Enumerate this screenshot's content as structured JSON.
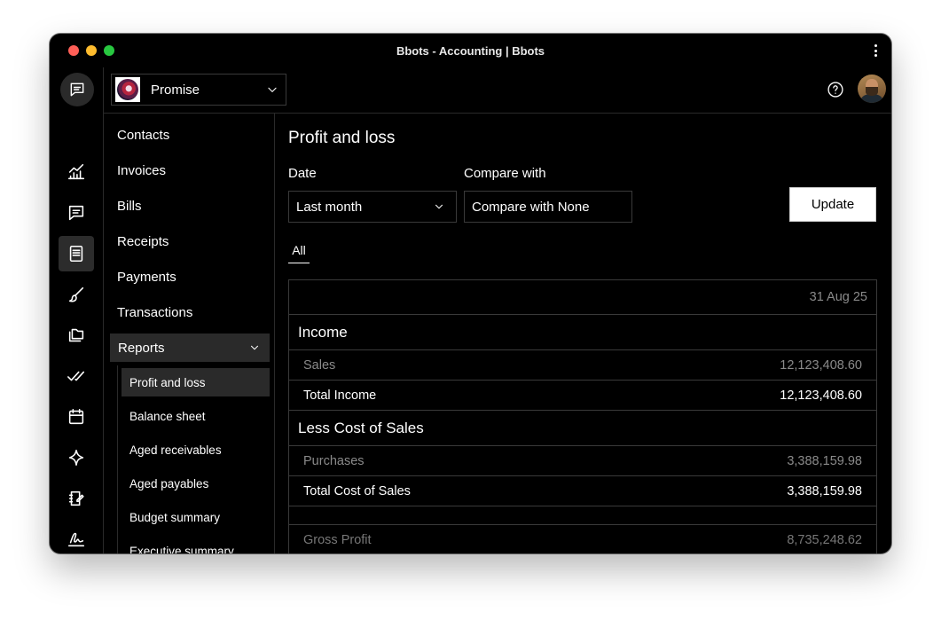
{
  "window": {
    "title": "Bbots - Accounting | Bbots"
  },
  "header": {
    "org_name": "Promise",
    "icons": [
      "help-icon",
      "bell-icon"
    ]
  },
  "rail": {
    "items": [
      "chart-icon",
      "message-icon",
      "book-icon",
      "brush-icon",
      "files-icon",
      "check-double-icon",
      "calendar-icon",
      "sparkle-icon",
      "notebook-icon",
      "signature-icon",
      "gear-icon"
    ],
    "active": "book-icon"
  },
  "sidebar": {
    "items": [
      {
        "label": "Contacts"
      },
      {
        "label": "Invoices"
      },
      {
        "label": "Bills"
      },
      {
        "label": "Receipts"
      },
      {
        "label": "Payments"
      },
      {
        "label": "Transactions"
      }
    ],
    "group": {
      "label": "Reports"
    },
    "subitems": [
      {
        "label": "Profit and loss",
        "active": true
      },
      {
        "label": "Balance sheet"
      },
      {
        "label": "Aged receivables"
      },
      {
        "label": "Aged payables"
      },
      {
        "label": "Budget summary"
      },
      {
        "label": "Executive summary"
      }
    ]
  },
  "main": {
    "title": "Profit and loss",
    "date_label": "Date",
    "date_value": "Last month",
    "compare_label": "Compare with",
    "compare_value": "Compare with None",
    "update_label": "Update",
    "tab": "All",
    "report": {
      "column_date": "31 Aug 25",
      "income_heading": "Income",
      "sales_label": "Sales",
      "sales_value": "12,123,408.60",
      "total_income_label": "Total Income",
      "total_income_value": "12,123,408.60",
      "cos_heading": "Less Cost of Sales",
      "purchases_label": "Purchases",
      "purchases_value": "3,388,159.98",
      "total_cos_label": "Total Cost of Sales",
      "total_cos_value": "3,388,159.98",
      "gross_profit_label": "Gross Profit",
      "gross_profit_value": "8,735,248.62"
    }
  }
}
